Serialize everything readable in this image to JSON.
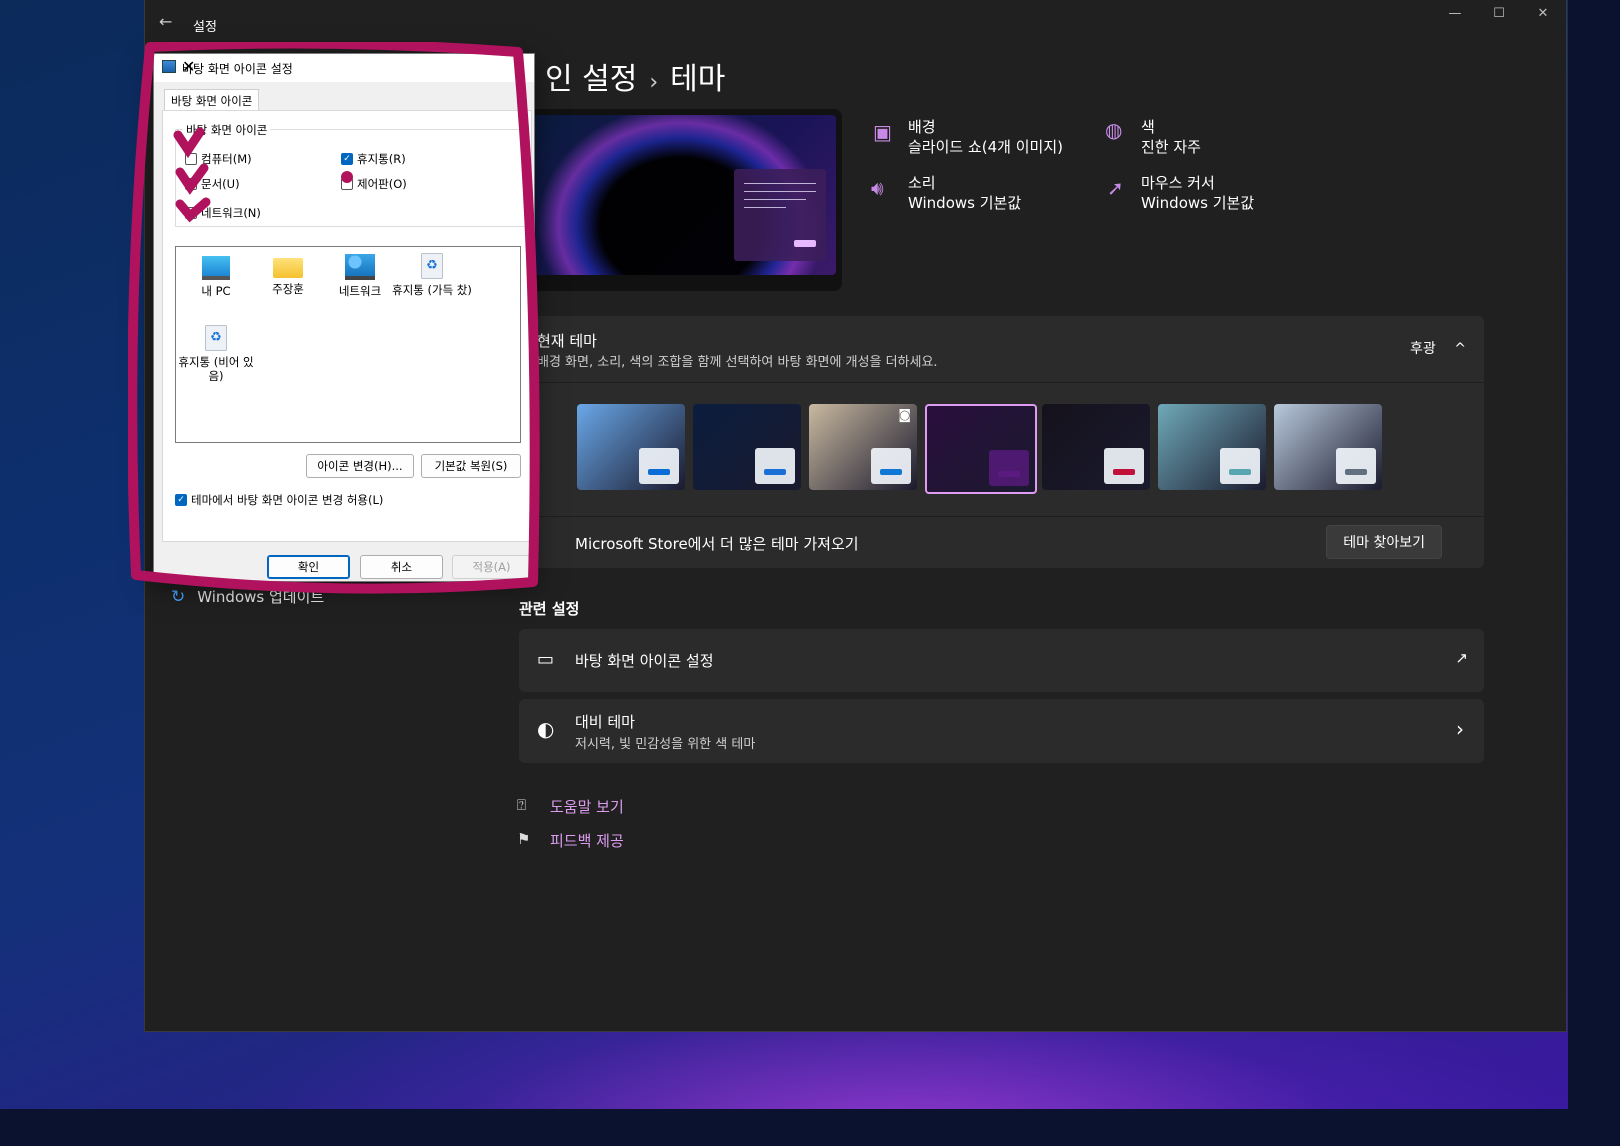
{
  "settings_window": {
    "title": "설정",
    "back_glyph": "←",
    "controls": {
      "minimize": "—",
      "maximize": "☐",
      "close": "✕"
    },
    "breadcrumb": {
      "parent": "인 설정",
      "separator": "›",
      "current": "테마"
    },
    "properties": [
      {
        "icon": "image-icon",
        "label": "배경",
        "value": "슬라이드 쇼(4개 이미지)"
      },
      {
        "icon": "palette-icon",
        "label": "색",
        "value": "진한 자주"
      },
      {
        "icon": "speaker-icon",
        "label": "소리",
        "value": "Windows 기본값"
      },
      {
        "icon": "mouse-cursor-icon",
        "label": "마우스 커서",
        "value": "Windows 기본값"
      }
    ],
    "current_theme": {
      "title": "현재 테마",
      "subtitle": "배경 화면, 소리, 색의 조합을 함께 선택하여 바탕 화면에 개성을 더하세요.",
      "value": "후광",
      "chevron": "^"
    },
    "theme_thumbnails": [
      {
        "bg": "#6aa8e8",
        "accent": "#0a6cd6"
      },
      {
        "bg": "#0b1d3e",
        "accent": "#1d6fd8"
      },
      {
        "bg": "#c9b9a0",
        "accent": "#1177d6"
      },
      {
        "bg": "#2a0f3d",
        "accent": "#5a1a80",
        "selected": true
      },
      {
        "bg": "#15121c",
        "accent": "#c0103a"
      },
      {
        "bg": "#6fa9b8",
        "accent": "#5aa6b0"
      },
      {
        "bg": "#b9c9dc",
        "accent": "#607080"
      }
    ],
    "store_row": {
      "text": "Microsoft Store에서 더 많은 테마 가져오기",
      "button": "테마 찾아보기"
    },
    "related_header": "관련 설정",
    "related": [
      {
        "title": "바탕 화면 아이콘 설정",
        "right_icon": "↗"
      },
      {
        "title": "대비 테마",
        "subtitle": "저시력, 빛 민감성을 위한 색 테마",
        "right_icon": "›"
      }
    ],
    "help_links": [
      {
        "icon": "help-icon",
        "label": "도움말 보기"
      },
      {
        "icon": "feedback-icon",
        "label": "피드백 제공"
      }
    ],
    "sidebar_item": "Windows 업데이트"
  },
  "dialog": {
    "title": "바탕 화면 아이콘 설정",
    "close": "✕",
    "tab": "바탕 화면 아이콘",
    "group_label": "바탕 화면 아이콘",
    "checkboxes": {
      "computer": {
        "label": "컴퓨터(M)",
        "checked": false
      },
      "recycle": {
        "label": "휴지통(R)",
        "checked": true
      },
      "documents": {
        "label": "문서(U)",
        "checked": false
      },
      "control_panel": {
        "label": "제어판(O)",
        "checked": false
      },
      "network": {
        "label": "네트워크(N)",
        "checked": false
      }
    },
    "icons": [
      {
        "label": "내 PC"
      },
      {
        "label": "주장훈"
      },
      {
        "label": "네트워크"
      },
      {
        "label": "휴지통 (가득 찼)"
      },
      {
        "label": "휴지통 (비어 있음)"
      }
    ],
    "change_icon_btn": "아이콘 변경(H)...",
    "restore_default_btn": "기본값 복원(S)",
    "allow_theme": {
      "label": "테마에서 바탕 화면 아이콘 변경 허용(L)",
      "checked": true
    },
    "ok": "확인",
    "cancel": "취소",
    "apply": "적용(A)"
  },
  "colors": {
    "accent": "#dd9cf0",
    "annotation": "#b0125e",
    "window_bg": "#202020",
    "card_bg": "#2b2b2b"
  }
}
